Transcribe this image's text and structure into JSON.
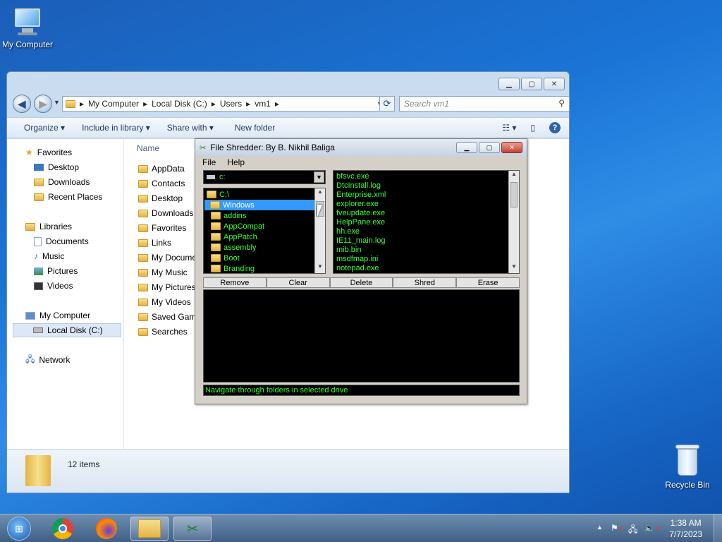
{
  "desktop": {
    "my_computer": "My Computer",
    "recycle_bin": "Recycle Bin"
  },
  "explorer": {
    "breadcrumb": [
      "My Computer",
      "Local Disk (C:)",
      "Users",
      "vm1"
    ],
    "search_placeholder": "Search vm1",
    "toolbar": {
      "organize": "Organize",
      "include": "Include in library",
      "share": "Share with",
      "new_folder": "New folder"
    },
    "column_name": "Name",
    "nav": {
      "favorites": "Favorites",
      "desktop": "Desktop",
      "downloads": "Downloads",
      "recent": "Recent Places",
      "libraries": "Libraries",
      "documents": "Documents",
      "music": "Music",
      "pictures": "Pictures",
      "videos": "Videos",
      "computer": "My Computer",
      "localdisk": "Local Disk (C:)",
      "network": "Network"
    },
    "files": [
      "AppData",
      "Contacts",
      "Desktop",
      "Downloads",
      "Favorites",
      "Links",
      "My Docume",
      "My Music",
      "My Pictures",
      "My Videos",
      "Saved Game",
      "Searches"
    ],
    "item_count": "12 items"
  },
  "shredder": {
    "title": "File Shredder: By B. Nikhil Baliga",
    "menu": [
      "File",
      "Help"
    ],
    "drive": "c:",
    "tree": [
      "C:\\",
      "Windows",
      "addins",
      "AppCompat",
      "AppPatch",
      "assembly",
      "Boot",
      "Branding"
    ],
    "files": [
      "bfsvc.exe",
      "DtcInstall.log",
      "Enterprise.xml",
      "explorer.exe",
      "fveupdate.exe",
      "HelpPane.exe",
      "hh.exe",
      "IE11_main.log",
      "mib.bin",
      "msdfmap.ini",
      "notepad.exe"
    ],
    "buttons": [
      "Remove",
      "Clear",
      "Delete",
      "Shred",
      "Erase"
    ],
    "status": "Navigate through folders in selected drive"
  },
  "taskbar": {
    "time": "1:38 AM",
    "date": "7/7/2023"
  }
}
